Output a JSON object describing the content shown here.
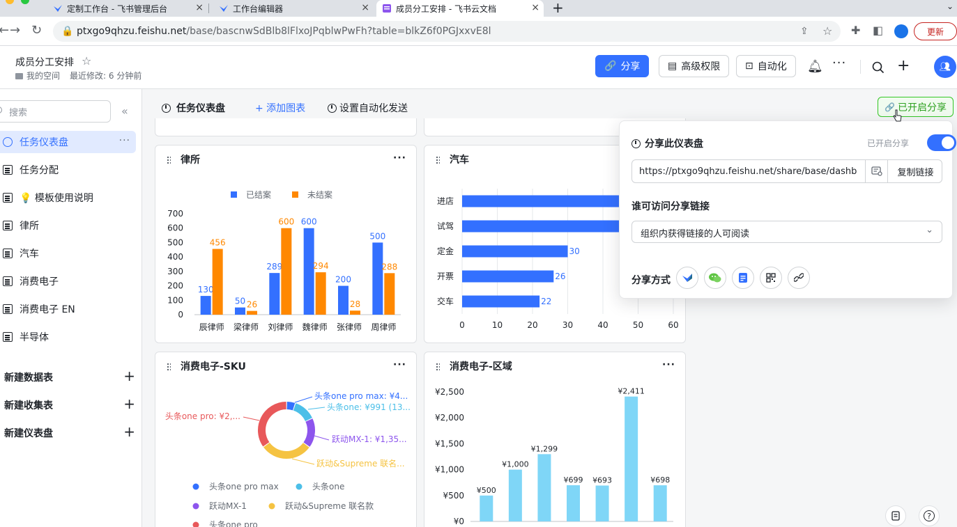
{
  "browser": {
    "tabs": [
      {
        "label": "定制工作台 - 飞书管理后台",
        "close": "×"
      },
      {
        "label": "工作台编辑器",
        "close": "×"
      },
      {
        "label": "成员分工安排 - 飞书云文档",
        "close": "×"
      }
    ],
    "new_tab": "+",
    "url_host": "ptxgo9qhzu.feishu.net",
    "url_path": "/base/bascnwSdBlb8lFlxoJPqblwPwFh?table=blkZ6f0PGJxxvE8l",
    "update_label": "更新"
  },
  "header": {
    "doc_title": "成员分工安排",
    "location": "我的空间",
    "last_modified": "最近修改: 6 分钟前",
    "share_label": "分享",
    "permissions_label": "高级权限",
    "automation_label": "自动化"
  },
  "sidebar": {
    "search_placeholder": "搜索",
    "items": [
      {
        "label": "任务仪表盘"
      },
      {
        "label": "任务分配"
      },
      {
        "label": "💡 模板使用说明"
      },
      {
        "label": "律所"
      },
      {
        "label": "汽车"
      },
      {
        "label": "消费电子"
      },
      {
        "label": "消费电子 EN"
      },
      {
        "label": "半导体"
      }
    ],
    "new_table": "新建数据表",
    "new_form": "新建收集表",
    "new_dashboard": "新建仪表盘"
  },
  "toolbar": {
    "title": "任务仪表盘",
    "add_chart": "+ 添加图表",
    "auto_send": "设置自动化发送",
    "shared": "已开启分享"
  },
  "cards": {
    "law": {
      "title": "律所"
    },
    "car": {
      "title": "汽车"
    },
    "sku": {
      "title": "消费电子-SKU"
    },
    "region": {
      "title": "消费电子-区域"
    }
  },
  "popover": {
    "title": "分享此仪表盘",
    "status": "已开启分享",
    "link": "https://ptxgo9qhzu.feishu.net/share/base/dashb",
    "copy_label": "复制链接",
    "access_label": "谁可访问分享链接",
    "access_value": "组织内获得链接的人可阅读",
    "share_method": "分享方式"
  },
  "chart_data": [
    {
      "type": "bar",
      "title": "律所",
      "categories": [
        "辰律师",
        "梁律师",
        "刘律师",
        "魏律师",
        "张律师",
        "周律师"
      ],
      "series": [
        {
          "name": "已结案",
          "values": [
            130,
            50,
            289,
            600,
            200,
            500
          ],
          "color": "#3370ff"
        },
        {
          "name": "未结案",
          "values": [
            456,
            26,
            600,
            294,
            28,
            288
          ],
          "color": "#ff8800"
        }
      ],
      "ylim": [
        0,
        700
      ],
      "yticks": [
        0,
        100,
        200,
        300,
        400,
        500,
        600,
        700
      ],
      "legend": "top"
    },
    {
      "type": "bar",
      "orientation": "horizontal",
      "title": "汽车",
      "categories": [
        "进店",
        "试驾",
        "定金",
        "开票",
        "交车"
      ],
      "values": [
        null,
        null,
        30,
        26,
        22
      ],
      "xlim": [
        0,
        60
      ],
      "xticks": [
        0,
        10,
        20,
        30,
        40,
        50,
        60
      ],
      "color": "#3370ff"
    },
    {
      "type": "pie",
      "subtype": "donut",
      "title": "消费电子-SKU",
      "slice_labels": [
        {
          "label": "头条one pro max: ¥4...",
          "color": "#3370ff"
        },
        {
          "label": "头条one: ¥991 (13...",
          "color": "#4cbfe8"
        },
        {
          "label": "跃动MX-1: ¥1,35...",
          "color": "#8d55ed"
        },
        {
          "label": "跃动&Supreme 联名...",
          "color": "#f5c342"
        },
        {
          "label": "头条one pro: ¥2,...",
          "color": "#e8585a"
        }
      ],
      "slices": [
        {
          "name": "头条one pro max",
          "fraction": 0.05,
          "color": "#3370ff"
        },
        {
          "name": "头条one",
          "fraction": 0.13,
          "color": "#4cbfe8"
        },
        {
          "name": "跃动MX-1",
          "fraction": 0.17,
          "color": "#8d55ed"
        },
        {
          "name": "跃动&Supreme 联名款",
          "fraction": 0.3,
          "color": "#f5c342"
        },
        {
          "name": "头条one pro",
          "fraction": 0.35,
          "color": "#e8585a"
        }
      ],
      "legend": "bottom"
    },
    {
      "type": "bar",
      "title": "消费电子-区域",
      "values": [
        500,
        1000,
        1299,
        699,
        693,
        2411,
        698
      ],
      "value_labels": [
        "¥500",
        "¥1,000",
        "¥1,299",
        "¥699",
        "¥693",
        "¥2,411",
        "¥698"
      ],
      "ylim": [
        0,
        2500
      ],
      "ytick_values": [
        0,
        500,
        1000,
        1500,
        2000,
        2500
      ],
      "ytick_labels": [
        "¥0",
        "¥500",
        "¥1,000",
        "¥1,500",
        "¥2,000",
        "¥2,500"
      ],
      "color": "#7fd6f7"
    }
  ]
}
